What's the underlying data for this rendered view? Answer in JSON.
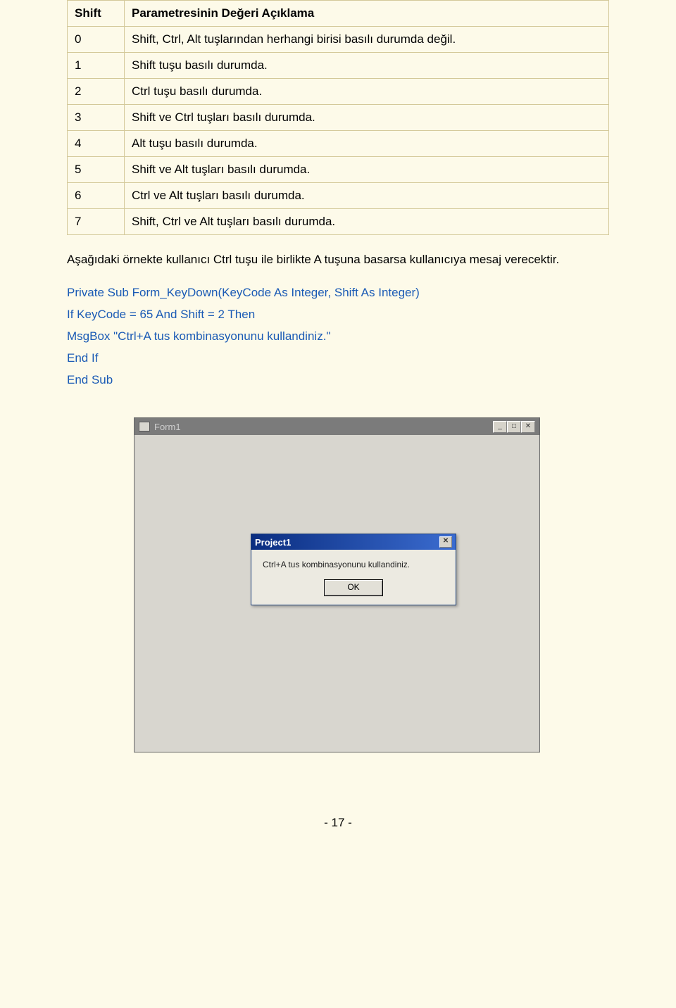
{
  "table": {
    "header_shift": "Shift",
    "header_desc": "Parametresinin Değeri Açıklama",
    "rows": [
      {
        "v": "0",
        "d": "Shift, Ctrl, Alt tuşlarından herhangi birisi basılı durumda değil."
      },
      {
        "v": "1",
        "d": "Shift tuşu basılı durumda."
      },
      {
        "v": "2",
        "d": "Ctrl tuşu basılı durumda."
      },
      {
        "v": "3",
        "d": "Shift ve Ctrl tuşları basılı durumda."
      },
      {
        "v": "4",
        "d": "Alt tuşu basılı durumda."
      },
      {
        "v": "5",
        "d": "Shift ve Alt tuşları basılı durumda."
      },
      {
        "v": "6",
        "d": "Ctrl ve Alt tuşları basılı durumda."
      },
      {
        "v": "7",
        "d": "Shift, Ctrl ve Alt tuşları basılı durumda."
      }
    ]
  },
  "paragraph": "Aşağıdaki örnekte kullanıcı Ctrl tuşu ile birlikte A tuşuna basarsa kullanıcıya mesaj verecektir.",
  "code": {
    "l1": "Private Sub Form_KeyDown(KeyCode As Integer, Shift As Integer)",
    "l2": "If KeyCode = 65 And Shift = 2 Then",
    "l3": "MsgBox \"Ctrl+A tus kombinasyonunu kullandiniz.\"",
    "l4": "End If",
    "l5": "End Sub"
  },
  "window": {
    "title": "Form1",
    "min": "_",
    "max": "□",
    "close": "✕"
  },
  "msgbox": {
    "title": "Project1",
    "close": "✕",
    "text": "Ctrl+A tus kombinasyonunu kullandiniz.",
    "ok": "OK"
  },
  "page_num": "- 17 -"
}
